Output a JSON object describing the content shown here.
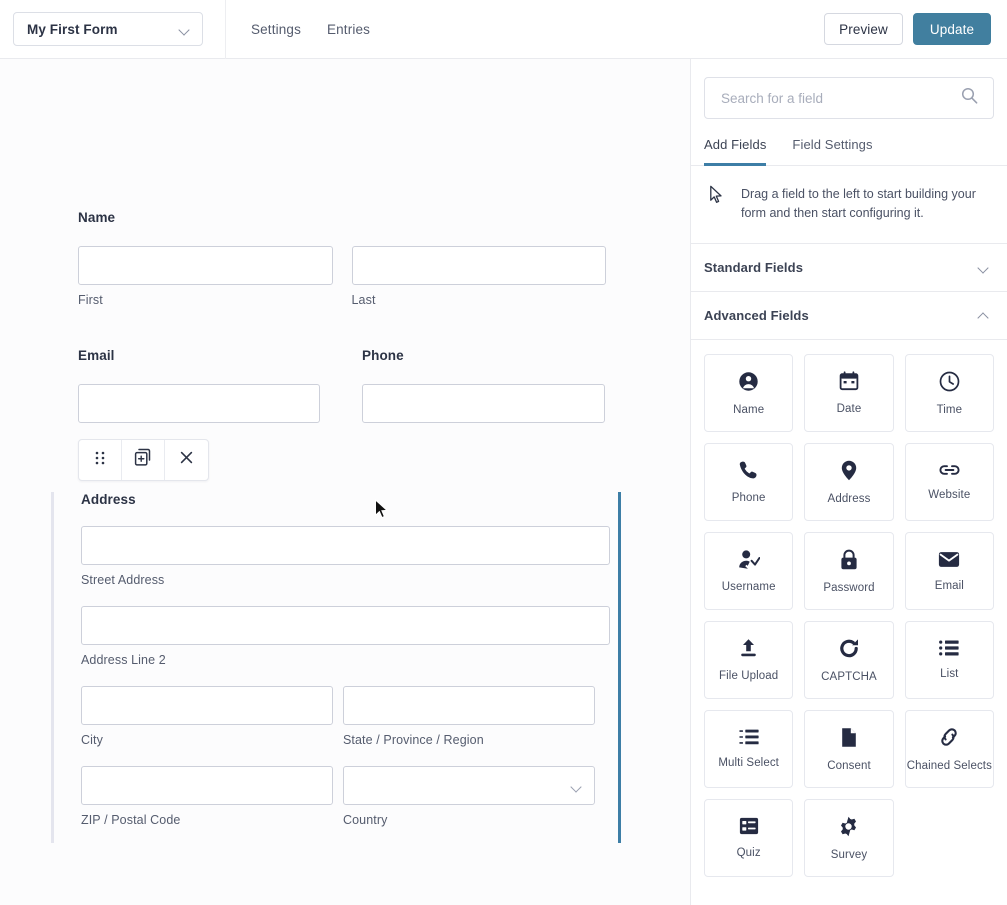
{
  "topbar": {
    "form_name": "My First Form",
    "form_select_icon": "chevron-down-icon",
    "nav": [
      {
        "label": "Settings"
      },
      {
        "label": "Entries"
      }
    ],
    "preview_label": "Preview",
    "update_label": "Update",
    "accent_color": "#417f9f"
  },
  "form": {
    "name_field": {
      "label": "Name",
      "sub_first": "First",
      "sub_last": "Last",
      "value_first": "",
      "value_last": ""
    },
    "email_field": {
      "label": "Email",
      "value": ""
    },
    "phone_field": {
      "label": "Phone",
      "value": ""
    },
    "field_toolbar": {
      "drag_handle": "drag-handle-icon",
      "duplicate": "duplicate-icon",
      "delete": "close-icon"
    },
    "address_field": {
      "label": "Address",
      "street_label": "Street Address",
      "street_value": "",
      "line2_label": "Address Line 2",
      "line2_value": "",
      "city_label": "City",
      "city_value": "",
      "state_label": "State / Province / Region",
      "state_value": "",
      "zip_label": "ZIP / Postal Code",
      "zip_value": "",
      "country_label": "Country",
      "country_value": "",
      "selected_accent": "#3d7ea6"
    }
  },
  "sidebar": {
    "search": {
      "placeholder": "Search for a field",
      "value": "",
      "icon": "search-icon"
    },
    "tabs": [
      {
        "label": "Add Fields",
        "active": true
      },
      {
        "label": "Field Settings",
        "active": false
      }
    ],
    "hint": {
      "icon": "cursor-arrow-icon",
      "text": "Drag a field to the left to start building your form and then start configuring it."
    },
    "sections": [
      {
        "title": "Standard Fields",
        "expanded": false,
        "chevron": "chevron-down-icon"
      },
      {
        "title": "Advanced Fields",
        "expanded": true,
        "chevron": "chevron-up-icon"
      }
    ],
    "advanced_fields": [
      {
        "label": "Name",
        "icon": "user-circle-icon"
      },
      {
        "label": "Date",
        "icon": "calendar-icon"
      },
      {
        "label": "Time",
        "icon": "clock-icon"
      },
      {
        "label": "Phone",
        "icon": "phone-icon"
      },
      {
        "label": "Address",
        "icon": "map-pin-icon"
      },
      {
        "label": "Website",
        "icon": "link-horizontal-icon"
      },
      {
        "label": "Username",
        "icon": "user-check-icon"
      },
      {
        "label": "Password",
        "icon": "lock-icon"
      },
      {
        "label": "Email",
        "icon": "envelope-icon"
      },
      {
        "label": "File Upload",
        "icon": "upload-icon"
      },
      {
        "label": "CAPTCHA",
        "icon": "refresh-icon"
      },
      {
        "label": "List",
        "icon": "list-icon"
      },
      {
        "label": "Multi Select",
        "icon": "multi-select-icon"
      },
      {
        "label": "Consent",
        "icon": "document-icon"
      },
      {
        "label": "Chained Selects",
        "icon": "chain-link-icon"
      },
      {
        "label": "Quiz",
        "icon": "quiz-icon"
      },
      {
        "label": "Survey",
        "icon": "gear-icon"
      }
    ]
  }
}
